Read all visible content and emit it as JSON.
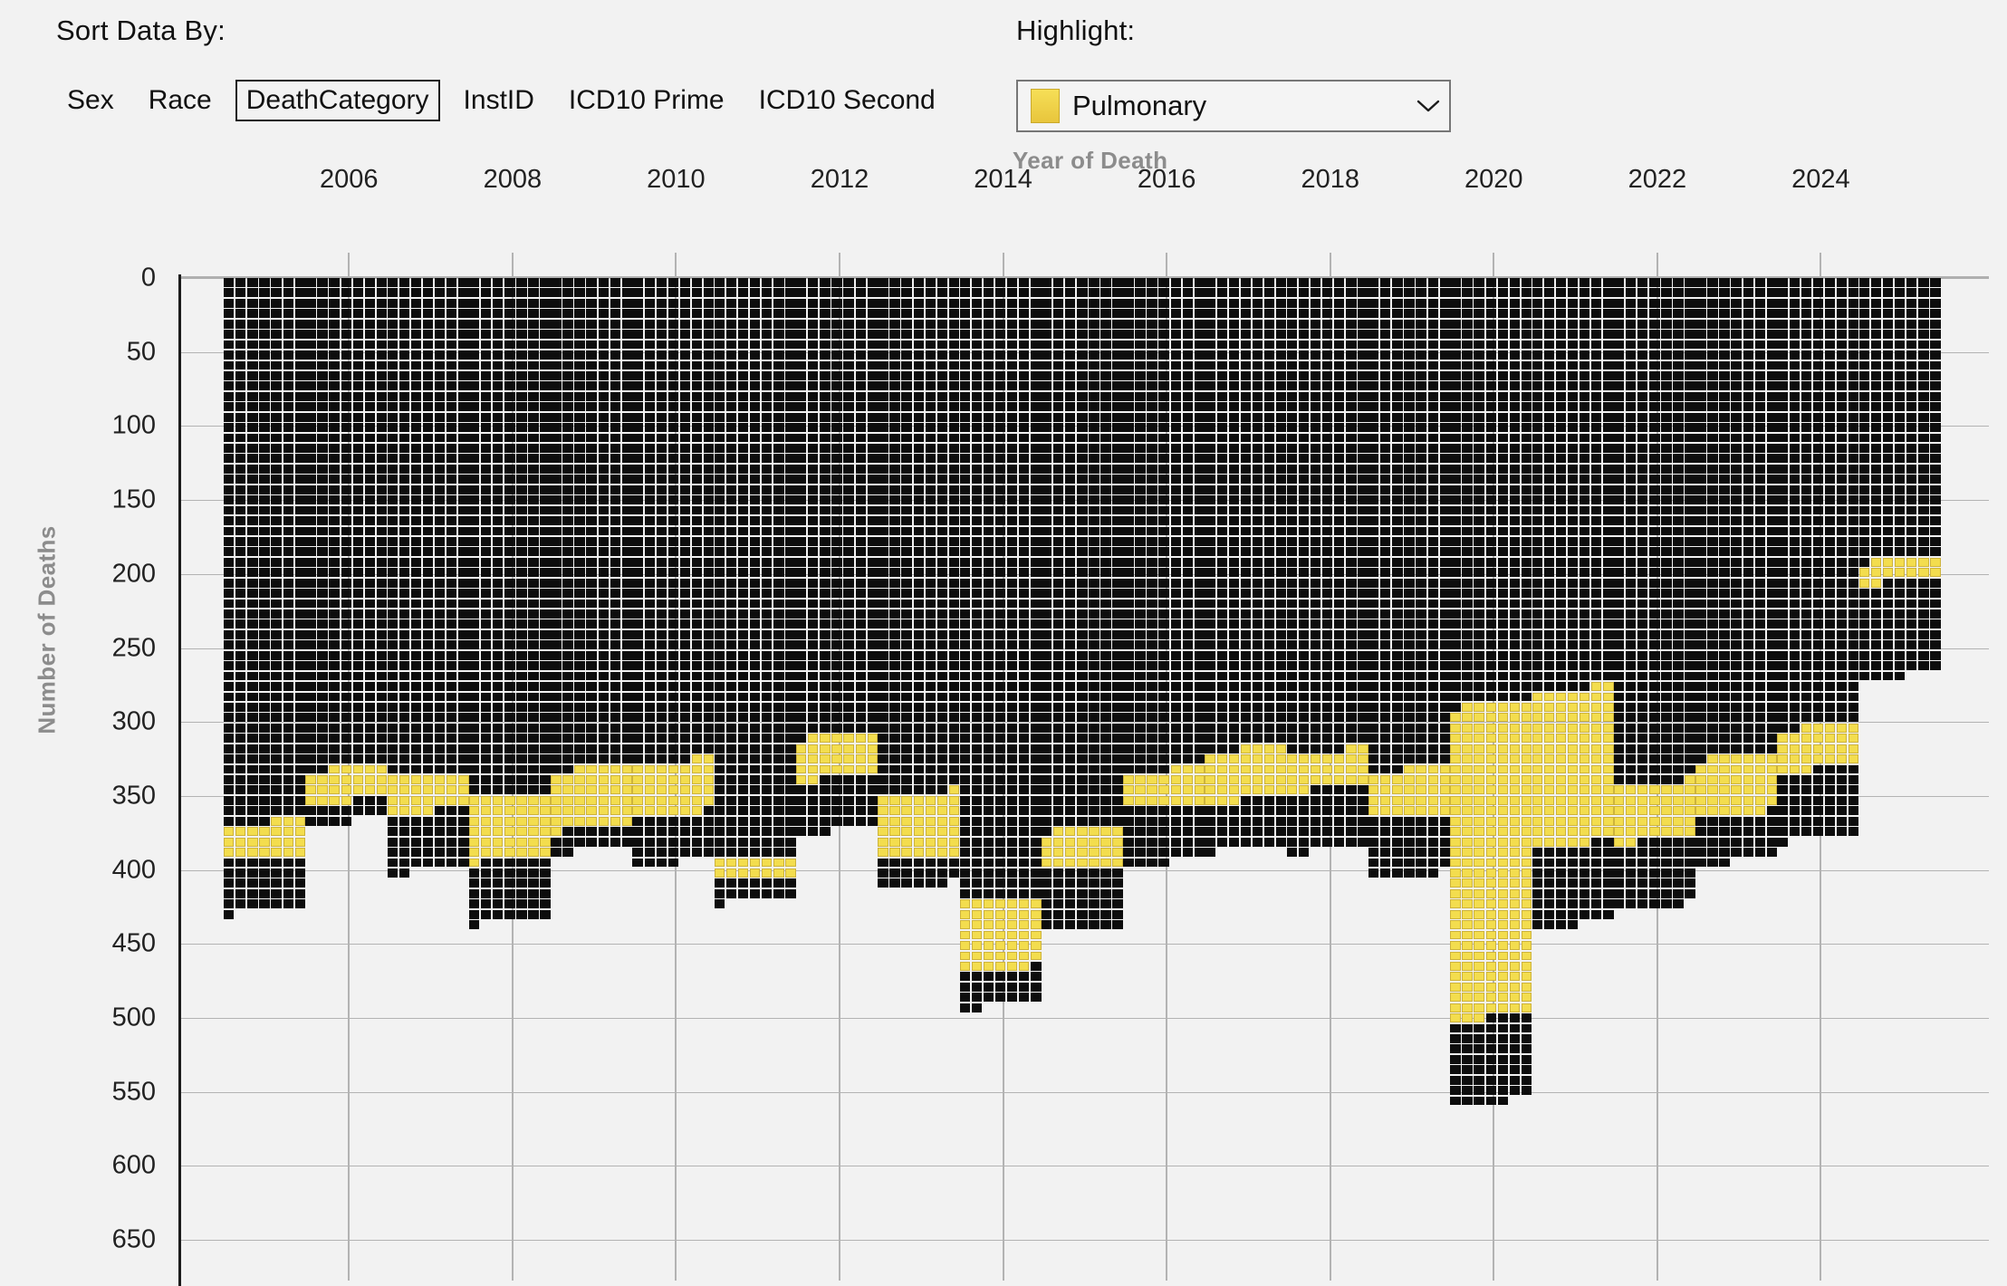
{
  "controls": {
    "sort_label": "Sort Data By:",
    "sort_options": [
      {
        "label": "Sex",
        "selected": false
      },
      {
        "label": "Race",
        "selected": false
      },
      {
        "label": "DeathCategory",
        "selected": true
      },
      {
        "label": "InstID",
        "selected": false
      },
      {
        "label": "ICD10 Prime",
        "selected": false
      },
      {
        "label": "ICD10 Second",
        "selected": false
      }
    ],
    "highlight_label": "Highlight:",
    "highlight_value": "Pulmonary",
    "highlight_swatch_color": "#f3dd4e",
    "chevron_icon": "chevron-down-icon"
  },
  "chart_data": {
    "type": "bar",
    "title": "Year of Death",
    "xlabel": "Year of Death",
    "ylabel": "Number of Deaths",
    "grid": true,
    "legend_position": "none",
    "y_inverted": true,
    "ylim": [
      0,
      675
    ],
    "yticks": [
      0,
      50,
      100,
      150,
      200,
      250,
      300,
      350,
      400,
      450,
      500,
      550,
      600,
      650
    ],
    "xticks": [
      2006,
      2008,
      2010,
      2012,
      2014,
      2016,
      2018,
      2020,
      2022,
      2024
    ],
    "categories": [
      2005,
      2006,
      2007,
      2008,
      2009,
      2010,
      2011,
      2012,
      2013,
      2014,
      2015,
      2016,
      2017,
      2018,
      2019,
      2020,
      2021,
      2022,
      2023,
      2024,
      2025
    ],
    "series": [
      {
        "name": "Other categories (above highlight)",
        "color": "#0d0d0d",
        "values": [
          368,
          331,
          336,
          350,
          331,
          327,
          392,
          309,
          349,
          420,
          372,
          333,
          318,
          320,
          332,
          288,
          278,
          342,
          323,
          303,
          190
        ]
      },
      {
        "name": "Pulmonary",
        "color": "#f3dd4e",
        "values": [
          24,
          23,
          25,
          43,
          41,
          36,
          14,
          29,
          43,
          48,
          27,
          24,
          35,
          25,
          32,
          212,
          105,
          38,
          40,
          29,
          15
        ]
      },
      {
        "name": "Other categories (below highlight)",
        "color": "#0d0d0d",
        "values": [
          36,
          14,
          40,
          42,
          15,
          33,
          15,
          36,
          20,
          24,
          42,
          39,
          33,
          42,
          41,
          58,
          55,
          46,
          32,
          47,
          65
        ]
      }
    ],
    "totals": [
      428,
      368,
      401,
      435,
      387,
      396,
      421,
      374,
      412,
      492,
      441,
      396,
      386,
      387,
      405,
      558,
      438,
      426,
      395,
      379,
      270
    ],
    "cell_unit": 1,
    "cells_per_row": 7,
    "notes": "Waffle-style stacked bar: each small square represents one death; yellow squares are the highlighted Pulmonary category."
  }
}
